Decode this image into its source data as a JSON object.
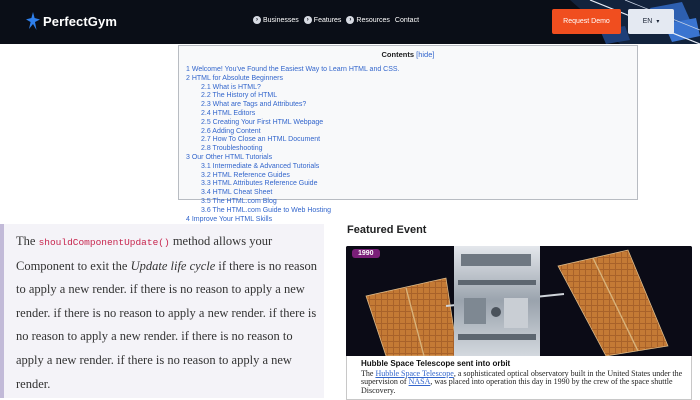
{
  "navbar": {
    "brand": "PerfectGym",
    "links": [
      {
        "label": "Businesses",
        "icon": "chevron-circle-icon"
      },
      {
        "label": "Features",
        "icon": "chevron-circle-icon"
      },
      {
        "label": "Resources",
        "icon": "chevron-circle-icon"
      },
      {
        "label": "Contact"
      }
    ],
    "demo_button": "Request Demo",
    "language": "EN"
  },
  "toc": {
    "title": "Contents",
    "toggle": "[hide]",
    "items": [
      {
        "text": "1 Welcome! You've Found the Easiest Way to Learn HTML and CSS.",
        "level": 1
      },
      {
        "text": "2 HTML for Absolute Beginners",
        "level": 1
      },
      {
        "text": "2.1 What is HTML?",
        "level": 2
      },
      {
        "text": "2.2 The History of HTML",
        "level": 2
      },
      {
        "text": "2.3 What are Tags and Attributes?",
        "level": 2
      },
      {
        "text": "2.4 HTML Editors",
        "level": 2
      },
      {
        "text": "2.5 Creating Your First HTML Webpage",
        "level": 2
      },
      {
        "text": "2.6 Adding Content",
        "level": 2
      },
      {
        "text": "2.7 How To Close an HTML Document",
        "level": 2
      },
      {
        "text": "2.8 Troubleshooting",
        "level": 2
      },
      {
        "text": "3 Our Other HTML Tutorials",
        "level": 1
      },
      {
        "text": "3.1 Intermediate & Advanced Tutorials",
        "level": 2
      },
      {
        "text": "3.2 HTML Reference Guides",
        "level": 2
      },
      {
        "text": "3.3 HTML Attributes Reference Guide",
        "level": 2
      },
      {
        "text": "3.4 HTML Cheat Sheet",
        "level": 2
      },
      {
        "text": "3.5 The HTML.com Blog",
        "level": 2
      },
      {
        "text": "3.6 The HTML.com Guide to Web Hosting",
        "level": 2
      },
      {
        "text": "4 Improve Your HTML Skills",
        "level": 1
      }
    ]
  },
  "quote": {
    "pre": "The ",
    "code": "shouldComponentUpdate()",
    "mid": " method allows your Component to exit the ",
    "em": "Update life cycle",
    "post": " if there is no reason to apply a new render. if there is no reason to apply a new render. if there is no reason to apply a new render. if there is no reason to apply a new render. if there is no reason to apply a new render. if there is no reason to apply a new render."
  },
  "featured": {
    "heading": "Featured Event",
    "badge": "1990",
    "title": "Hubble Space Telescope sent into orbit",
    "desc_pre": "The ",
    "link1": "Hubble Space Telescope",
    "desc_mid": ", a sophisticated optical observatory built in the United States under the supervision of ",
    "link2": "NASA",
    "desc_post": ", was placed into operation this day in 1990 by the crew of the space shuttle Discovery."
  },
  "colors": {
    "nav_bg": "#0a0e17",
    "demo_button": "#f04e1f",
    "link": "#3366cc",
    "badge": "#7a1f78"
  }
}
